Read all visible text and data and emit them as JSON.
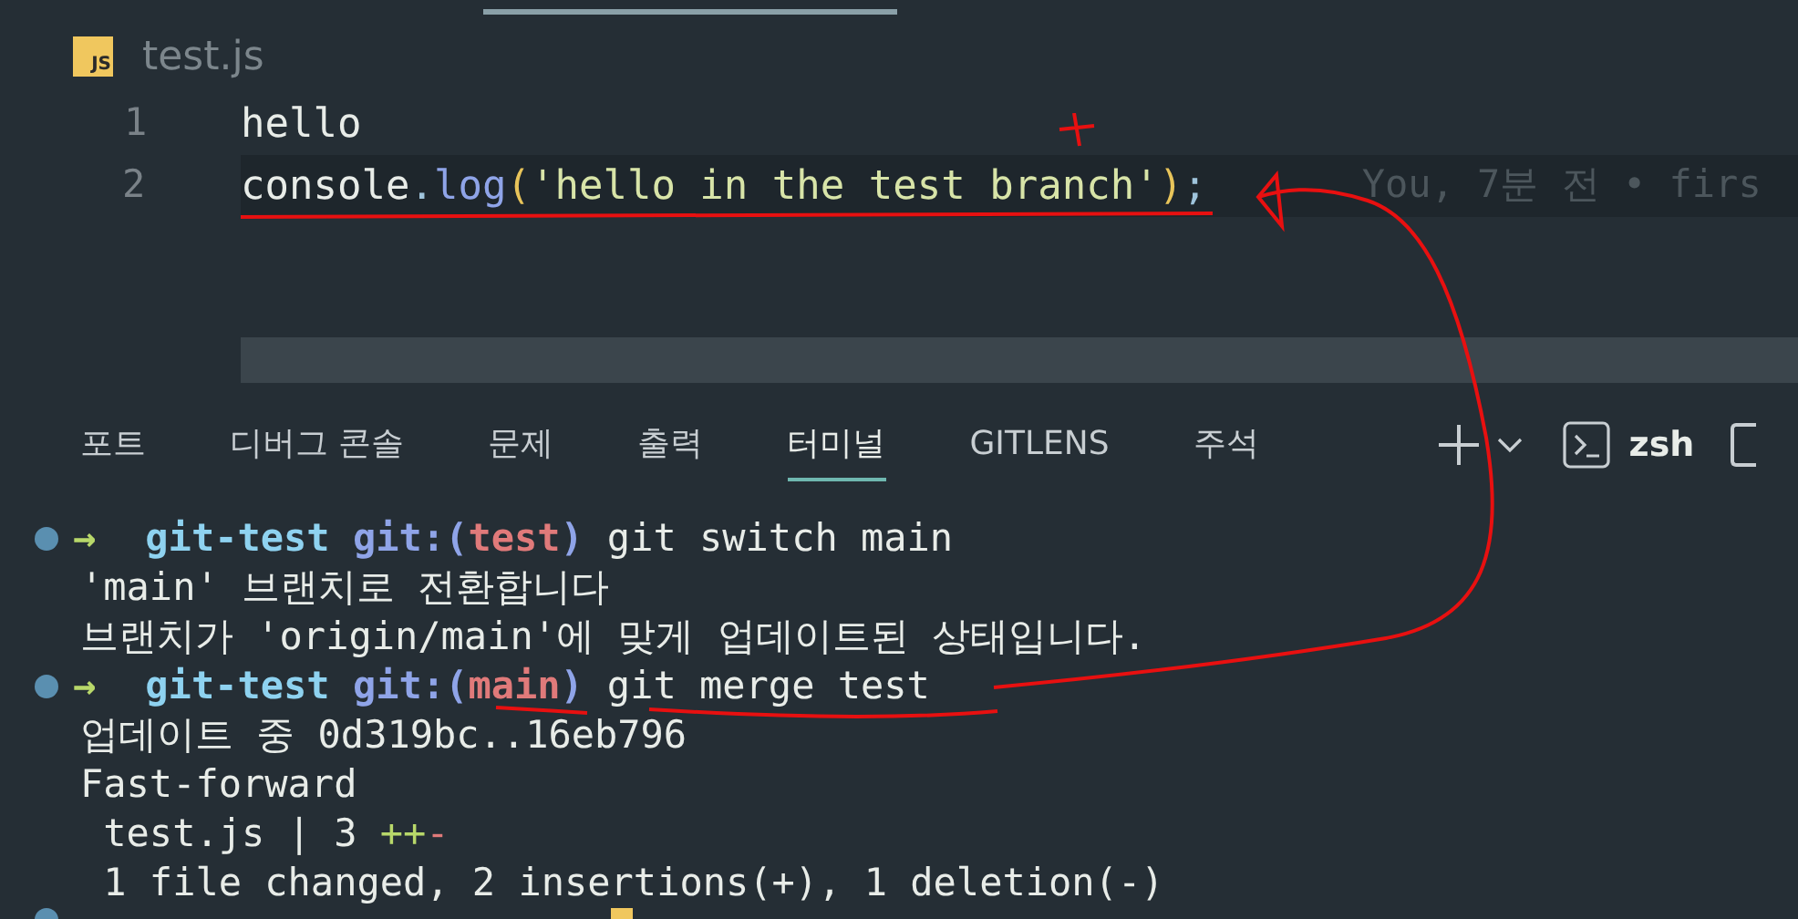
{
  "editor": {
    "file_icon": "JS",
    "file_name": "test.js",
    "lines": [
      {
        "number": "1",
        "highlighted": false,
        "tokens": [
          {
            "kind": "plain",
            "text": "hello"
          }
        ]
      },
      {
        "number": "2",
        "highlighted": true,
        "tokens": [
          {
            "kind": "plain",
            "text": "console"
          },
          {
            "kind": "punct",
            "text": "."
          },
          {
            "kind": "func",
            "text": "log"
          },
          {
            "kind": "paren",
            "text": "("
          },
          {
            "kind": "string",
            "text": "'hello in the test branch'"
          },
          {
            "kind": "paren",
            "text": ")"
          },
          {
            "kind": "punct",
            "text": ";"
          }
        ],
        "blame": "You, 7분 전 • firs"
      }
    ]
  },
  "panel_tabs": [
    {
      "label": "포트",
      "selected": false
    },
    {
      "label": "디버그 콘솔",
      "selected": false
    },
    {
      "label": "문제",
      "selected": false
    },
    {
      "label": "출력",
      "selected": false
    },
    {
      "label": "터미널",
      "selected": true
    },
    {
      "label": "GITLENS",
      "selected": false
    },
    {
      "label": "주석",
      "selected": false
    }
  ],
  "terminal_name": "zsh",
  "terminal": [
    {
      "kind": "prompt",
      "arrow": "→",
      "dir": "git-test",
      "git": "git:(",
      "branch": "test",
      "close": ")",
      "command": "git switch main"
    },
    {
      "kind": "output",
      "text": "'main' 브랜치로 전환합니다"
    },
    {
      "kind": "output",
      "text": "브랜치가 'origin/main'에 맞게 업데이트된 상태입니다."
    },
    {
      "kind": "prompt",
      "arrow": "→",
      "dir": "git-test",
      "git": "git:(",
      "branch": "main",
      "close": ")",
      "command": "git merge test"
    },
    {
      "kind": "output",
      "text": "업데이트 중 0d319bc..16eb796"
    },
    {
      "kind": "output",
      "text": "Fast-forward"
    },
    {
      "kind": "diffstat",
      "text": " test.js | 3 ",
      "plus": "++",
      "minus": "-"
    },
    {
      "kind": "output",
      "text": " 1 file changed, 2 insertions(+), 1 deletion(-)"
    },
    {
      "kind": "partial_prompt",
      "cursor": true
    }
  ]
}
